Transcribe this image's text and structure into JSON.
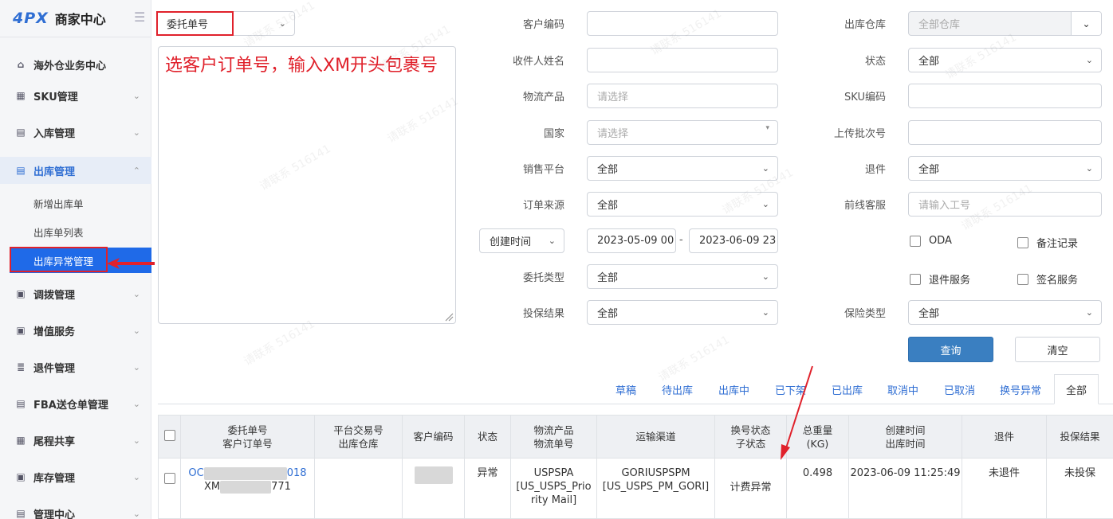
{
  "sidebar": {
    "brand": "4PX",
    "title": "商家中心",
    "items": [
      {
        "label": "海外仓业务中心",
        "icon": "home-icon"
      },
      {
        "label": "SKU管理",
        "icon": "cube-icon"
      },
      {
        "label": "入库管理",
        "icon": "inbound-icon"
      },
      {
        "label": "出库管理",
        "icon": "outbound-icon"
      },
      {
        "label": "调拨管理",
        "icon": "transfer-icon"
      },
      {
        "label": "增值服务",
        "icon": "service-icon"
      },
      {
        "label": "退件管理",
        "icon": "return-icon"
      },
      {
        "label": "FBA送仓单管理",
        "icon": "fba-icon"
      },
      {
        "label": "尾程共享",
        "icon": "share-icon"
      },
      {
        "label": "库存管理",
        "icon": "inventory-icon"
      },
      {
        "label": "管理中心",
        "icon": "manage-icon"
      }
    ],
    "sub_items": [
      "新增出库单",
      "出库单列表",
      "出库异常管理"
    ]
  },
  "filter": {
    "order_type_select": "委托单号",
    "annotation": "选客户订单号，输入XM开头包裹号",
    "customer_code_label": "客户编码",
    "recipient_label": "收件人姓名",
    "product_label": "物流产品",
    "product_placeholder": "请选择",
    "country_label": "国家",
    "country_placeholder": "请选择",
    "platform_label": "销售平台",
    "platform_value": "全部",
    "source_label": "订单来源",
    "source_value": "全部",
    "time_type": "创建时间",
    "date_start": "2023-05-09 00",
    "date_sep": "-",
    "date_end": "2023-06-09 23",
    "delegate_type_label": "委托类型",
    "delegate_type_value": "全部",
    "insure_result_label": "投保结果",
    "insure_result_value": "全部",
    "warehouse_label": "出库仓库",
    "warehouse_value": "全部仓库",
    "status_label": "状态",
    "status_value": "全部",
    "sku_label": "SKU编码",
    "batch_label": "上传批次号",
    "return_label": "退件",
    "return_value": "全部",
    "cs_label": "前线客服",
    "cs_placeholder": "请输入工号",
    "cb_oda": "ODA",
    "cb_remark": "备注记录",
    "cb_return_service": "退件服务",
    "cb_sign_service": "签名服务",
    "insure_type_label": "保险类型",
    "insure_type_value": "全部",
    "query_button": "查询",
    "clear_button": "清空"
  },
  "tabs": [
    "草稿",
    "待出库",
    "出库中",
    "已下架",
    "已出库",
    "取消中",
    "已取消",
    "换号异常",
    "全部"
  ],
  "table": {
    "headers": [
      [
        "委托单号",
        "客户订单号"
      ],
      [
        "平台交易号",
        "出库仓库"
      ],
      [
        "客户编码"
      ],
      [
        "状态"
      ],
      [
        "物流产品",
        "物流单号"
      ],
      [
        "运输渠道"
      ],
      [
        "换号状态",
        "子状态"
      ],
      [
        "总重量",
        "(KG)"
      ],
      [
        "创建时间",
        "出库时间"
      ],
      [
        "退件"
      ],
      [
        "投保结果"
      ]
    ],
    "row": {
      "order_no_prefix": "OC",
      "order_no_suffix": "018",
      "customer_order_prefix": "XM",
      "customer_order_suffix": "771",
      "status": "异常",
      "product_l1": "USPSPA",
      "product_l2": "[US_USPS_Prio",
      "product_l3": "rity Mail]",
      "channel_l1": "GORIUSPSPM",
      "channel_l2": "[US_USPS_PM_GORI]",
      "sub_status": "计费异常",
      "weight": "0.498",
      "created": "2023-06-09 11:25:49",
      "return": "未退件",
      "insure": "未投保"
    }
  },
  "watermark_text": "请联系 516141"
}
